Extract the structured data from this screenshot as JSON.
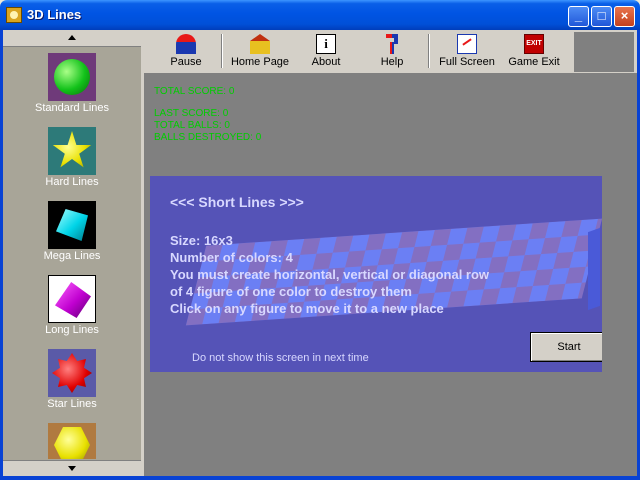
{
  "window": {
    "title": "3D Lines"
  },
  "sidebar": {
    "levels": [
      {
        "label": "Standard Lines"
      },
      {
        "label": "Hard Lines"
      },
      {
        "label": "Mega Lines"
      },
      {
        "label": "Long Lines"
      },
      {
        "label": "Star Lines"
      }
    ]
  },
  "toolbar": {
    "pause": "Pause",
    "home": "Home Page",
    "about": "About",
    "help": "Help",
    "full_screen": "Full Screen",
    "exit": "Game Exit",
    "about_glyph": "i",
    "exit_glyph": "EXIT"
  },
  "stats": {
    "total_score": "TOTAL SCORE: 0",
    "last_score": "LAST SCORE: 0",
    "total_balls": "TOTAL BALLS: 0",
    "balls_destroyed": "BALLS DESTROYED: 0"
  },
  "dialog": {
    "title": "<<< Short Lines >>>",
    "size": "Size: 16x3",
    "colors": "Number of colors:  4",
    "line1": "You must create horizontal, vertical or diagonal row",
    "line2": "of 4 figure of one color to destroy them",
    "line3": "Click on any figure to move it to a new place",
    "checkbox": "Do not show this screen in next time",
    "start": "Start"
  }
}
